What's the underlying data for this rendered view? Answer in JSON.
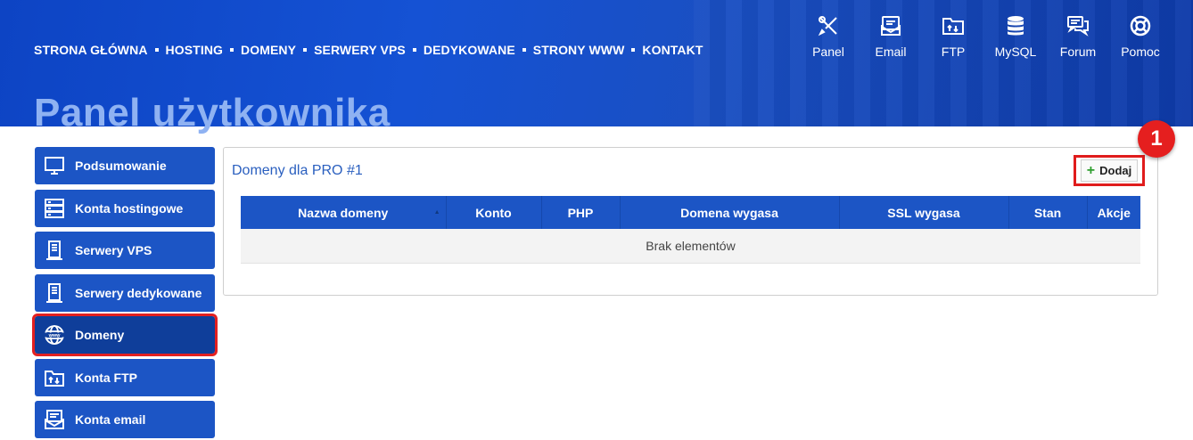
{
  "nav": {
    "items": [
      "STRONA GŁÓWNA",
      "HOSTING",
      "DOMENY",
      "SERWERY VPS",
      "DEDYKOWANE",
      "STRONY WWW",
      "KONTAKT"
    ]
  },
  "tools": [
    {
      "label": "Panel",
      "icon": "tools-icon"
    },
    {
      "label": "Email",
      "icon": "email-icon"
    },
    {
      "label": "FTP",
      "icon": "ftp-folder-icon"
    },
    {
      "label": "MySQL",
      "icon": "database-icon"
    },
    {
      "label": "Forum",
      "icon": "forum-icon"
    },
    {
      "label": "Pomoc",
      "icon": "lifebuoy-icon"
    }
  ],
  "page_title": "Panel użytkownika",
  "sidebar": {
    "items": [
      {
        "label": "Podsumowanie",
        "icon": "monitor-icon"
      },
      {
        "label": "Konta hostingowe",
        "icon": "server-stack-icon"
      },
      {
        "label": "Serwery VPS",
        "icon": "server-icon"
      },
      {
        "label": "Serwery dedykowane",
        "icon": "server-icon"
      },
      {
        "label": "Domeny",
        "icon": "www-globe-icon"
      },
      {
        "label": "Konta FTP",
        "icon": "ftp-folder-icon"
      },
      {
        "label": "Konta email",
        "icon": "email-icon"
      }
    ],
    "active": "Domeny"
  },
  "panel": {
    "title": "Domeny dla PRO #1",
    "add_label": "Dodaj",
    "badge": "1",
    "columns": [
      "Nazwa domeny",
      "Konto",
      "PHP",
      "Domena wygasa",
      "SSL wygasa",
      "Stan",
      "Akcje"
    ],
    "empty_text": "Brak elementów"
  },
  "colors": {
    "header_blue": "#1552d4",
    "sidebar_blue": "#1c55c5",
    "active_blue": "#0f3e9a",
    "highlight_red": "#e01c1c",
    "title_text": "#2a5fbf"
  }
}
